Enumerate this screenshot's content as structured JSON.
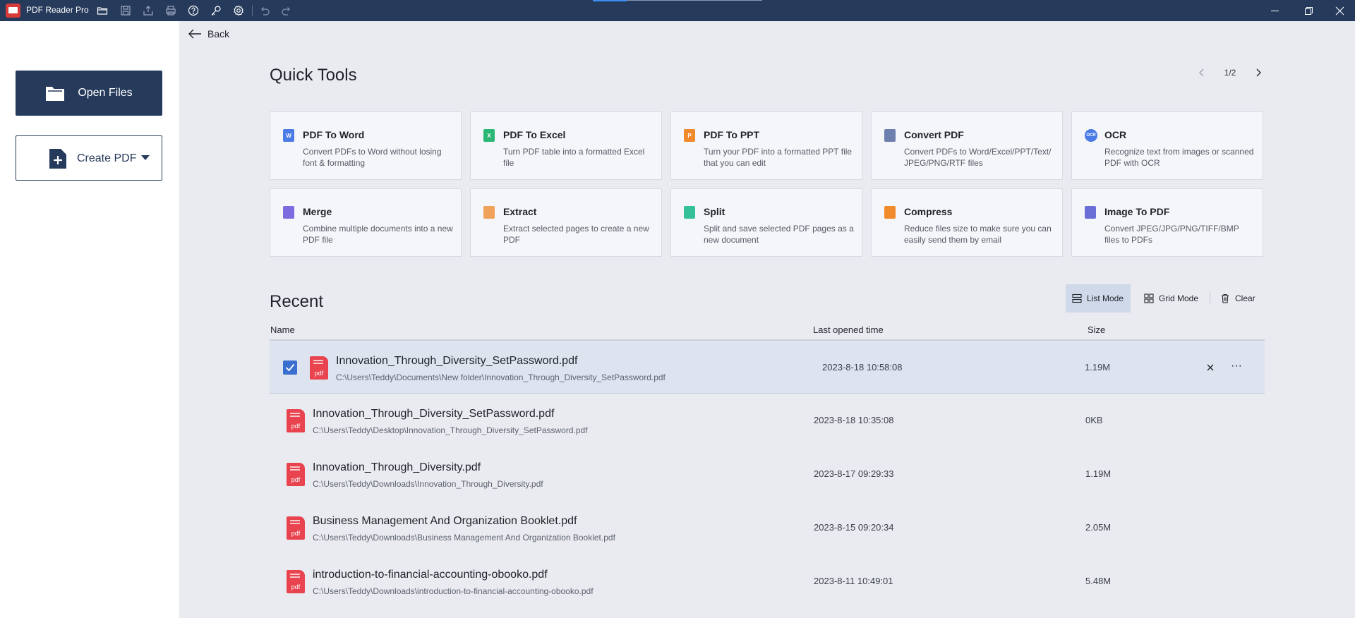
{
  "app": {
    "name": "PDF Reader Pro",
    "toolbar_icons": [
      "open-folder-icon",
      "save-icon",
      "share-icon",
      "print-icon",
      "help-icon",
      "key-icon",
      "settings-icon",
      "undo-icon",
      "redo-icon"
    ],
    "colors": {
      "titlebar": "#263a5c",
      "accent": "#3a6fcf",
      "pdf_red": "#e8434f"
    }
  },
  "sidebar": {
    "open_files_label": "Open Files",
    "create_pdf_label": "Create PDF"
  },
  "nav": {
    "back_label": "Back"
  },
  "quick_tools": {
    "title": "Quick Tools",
    "page_indicator": "1/2",
    "tools": [
      {
        "title": "PDF To Word",
        "desc": "Convert PDFs to Word without losing font & formatting",
        "icon": "word-icon",
        "glyph": "W",
        "color": "#4a7be6"
      },
      {
        "title": "PDF To Excel",
        "desc": "Turn PDF table into a formatted Excel file",
        "icon": "excel-icon",
        "glyph": "X",
        "color": "#2bb673"
      },
      {
        "title": "PDF To PPT",
        "desc": "Turn your PDF into a formatted PPT file that you can edit",
        "icon": "ppt-icon",
        "glyph": "P",
        "color": "#f08a2c"
      },
      {
        "title": "Convert PDF",
        "desc": "Convert PDFs to Word/Excel/PPT/Text/ JPEG/PNG/RTF files",
        "icon": "convert-icon",
        "glyph": "",
        "color": "#6d7fae"
      },
      {
        "title": "OCR",
        "desc": "Recognize text from images or scanned PDF with OCR",
        "icon": "ocr-icon",
        "glyph": "OCR",
        "color": "#4a7be6"
      },
      {
        "title": "Merge",
        "desc": "Combine multiple documents into a new PDF file",
        "icon": "merge-icon",
        "glyph": "",
        "color": "#7b6de0"
      },
      {
        "title": "Extract",
        "desc": "Extract selected pages to create a new PDF",
        "icon": "extract-icon",
        "glyph": "",
        "color": "#f0a25a"
      },
      {
        "title": "Split",
        "desc": "Split and save selected PDF pages as a new document",
        "icon": "split-icon",
        "glyph": "",
        "color": "#34c199"
      },
      {
        "title": "Compress",
        "desc": "Reduce files size to make sure you can easily send them by email",
        "icon": "compress-icon",
        "glyph": "",
        "color": "#f08a2c"
      },
      {
        "title": "Image To PDF",
        "desc": "Convert JPEG/JPG/PNG/TIFF/BMP files to PDFs",
        "icon": "image-icon",
        "glyph": "",
        "color": "#6a6fd6"
      }
    ]
  },
  "recent": {
    "title": "Recent",
    "list_mode_label": "List Mode",
    "grid_mode_label": "Grid Mode",
    "clear_label": "Clear",
    "columns": {
      "name": "Name",
      "time": "Last opened time",
      "size": "Size"
    },
    "files": [
      {
        "name": "Innovation_Through_Diversity_SetPassword.pdf",
        "path": "C:\\Users\\Teddy\\Documents\\New folder\\Innovation_Through_Diversity_SetPassword.pdf",
        "time": "2023-8-18  10:58:08",
        "size": "1.19M",
        "selected": true,
        "tag": "pdf"
      },
      {
        "name": "Innovation_Through_Diversity_SetPassword.pdf",
        "path": "C:\\Users\\Teddy\\Desktop\\Innovation_Through_Diversity_SetPassword.pdf",
        "time": "2023-8-18  10:35:08",
        "size": "0KB",
        "selected": false,
        "tag": "pdf"
      },
      {
        "name": "Innovation_Through_Diversity.pdf",
        "path": "C:\\Users\\Teddy\\Downloads\\Innovation_Through_Diversity.pdf",
        "time": "2023-8-17  09:29:33",
        "size": "1.19M",
        "selected": false,
        "tag": "pdf"
      },
      {
        "name": "Business Management And Organization Booklet.pdf",
        "path": "C:\\Users\\Teddy\\Downloads\\Business Management And Organization Booklet.pdf",
        "time": "2023-8-15  09:20:34",
        "size": "2.05M",
        "selected": false,
        "tag": "pdf"
      },
      {
        "name": "introduction-to-financial-accounting-obooko.pdf",
        "path": "C:\\Users\\Teddy\\Downloads\\introduction-to-financial-accounting-obooko.pdf",
        "time": "2023-8-11  10:49:01",
        "size": "5.48M",
        "selected": false,
        "tag": "pdf"
      }
    ],
    "row_more_glyph": "···"
  }
}
